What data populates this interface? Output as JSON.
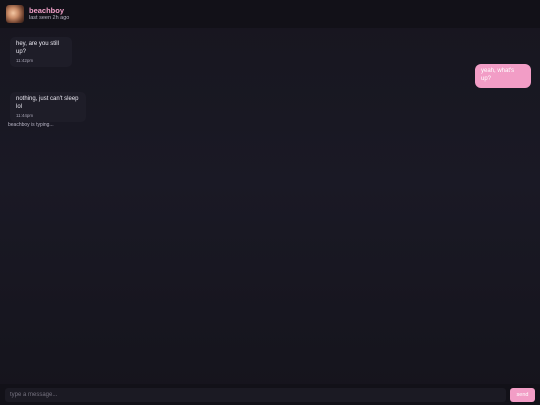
{
  "header": {
    "contact_name": "beachboy",
    "contact_status": "last seen 2h ago"
  },
  "messages": [
    {
      "direction": "incoming",
      "text": "hey, are you still up?",
      "time": "11:42pm"
    },
    {
      "direction": "outgoing",
      "text": "yeah, what's up?",
      "time": ""
    },
    {
      "direction": "incoming",
      "text": "nothing, just can't sleep lol",
      "time": "11:44pm"
    }
  ],
  "typing_indicator": "beachboy is typing...",
  "composer": {
    "placeholder": "type a message...",
    "value": "",
    "send_label": "send"
  },
  "colors": {
    "accent": "#f29dc6",
    "background": "#17161f",
    "bubble_incoming": "#1e1d28"
  }
}
